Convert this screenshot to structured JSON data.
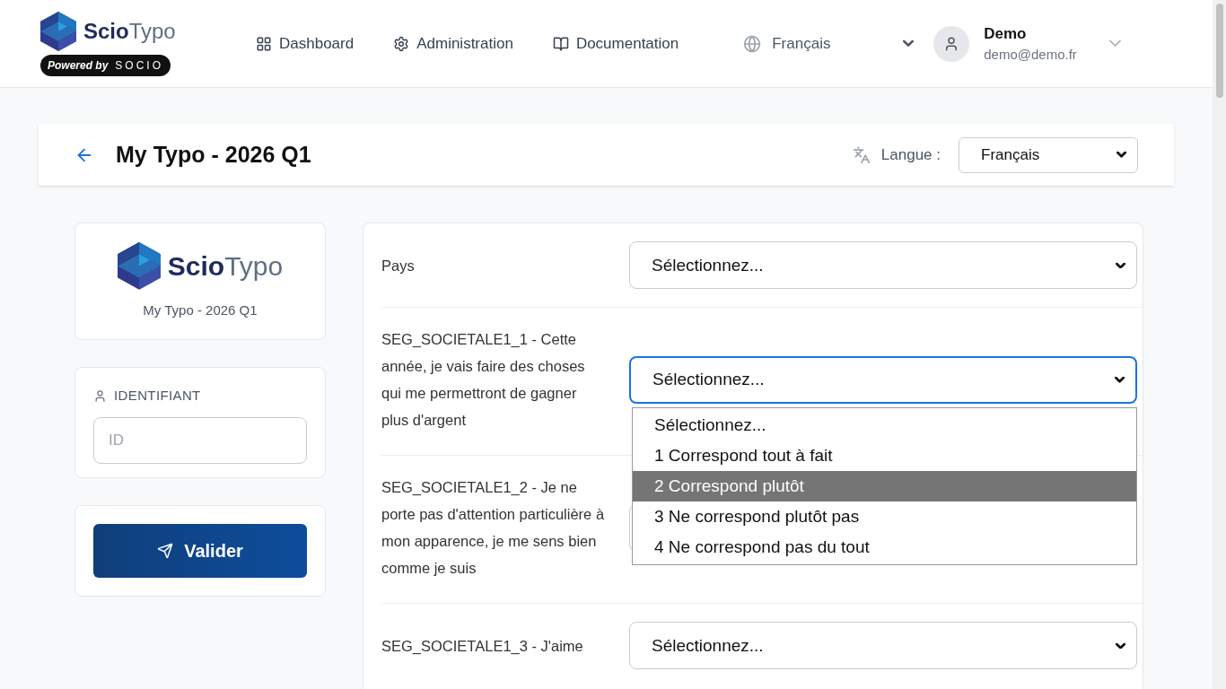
{
  "header": {
    "logo": {
      "bold": "Scio",
      "light": "Typo"
    },
    "powered_by": {
      "label": "Powered by",
      "brand": "SOCIO"
    },
    "nav": [
      {
        "label": "Dashboard",
        "kind": "dashboard"
      },
      {
        "label": "Administration",
        "kind": "settings"
      },
      {
        "label": "Documentation",
        "kind": "book"
      }
    ],
    "language": "Français",
    "user": {
      "name": "Demo",
      "email": "demo@demo.fr"
    }
  },
  "page": {
    "title": "My Typo - 2026 Q1",
    "language_label": "Langue :",
    "language_value": "Français"
  },
  "sidebar": {
    "logo": {
      "bold": "Scio",
      "light": "Typo"
    },
    "caption": "My Typo - 2026 Q1",
    "id_label": "IDENTIFIANT",
    "id_placeholder": "ID",
    "submit": "Valider"
  },
  "questions": [
    {
      "label": "Pays",
      "value": "Sélectionnez...",
      "focused": false
    },
    {
      "label": "SEG_SOCIETALE1_1 - Cette année, je vais faire des choses qui me permettront de gagner plus d'argent",
      "value": "Sélectionnez...",
      "focused": true,
      "expanded": true,
      "options": [
        {
          "label": "Sélectionnez...",
          "highlighted": false
        },
        {
          "label": "1 Correspond tout à fait",
          "highlighted": false
        },
        {
          "label": "2 Correspond plutôt",
          "highlighted": true
        },
        {
          "label": "3 Ne correspond plutôt pas",
          "highlighted": false
        },
        {
          "label": "4 Ne correspond pas du tout",
          "highlighted": false
        }
      ]
    },
    {
      "label": "SEG_SOCIETALE1_2 - Je ne porte pas d'attention particulière à mon apparence, je me sens bien comme je suis",
      "focused": false
    },
    {
      "label": "SEG_SOCIETALE1_3 - J'aime",
      "value": "Sélectionnez...",
      "focused": false
    }
  ]
}
